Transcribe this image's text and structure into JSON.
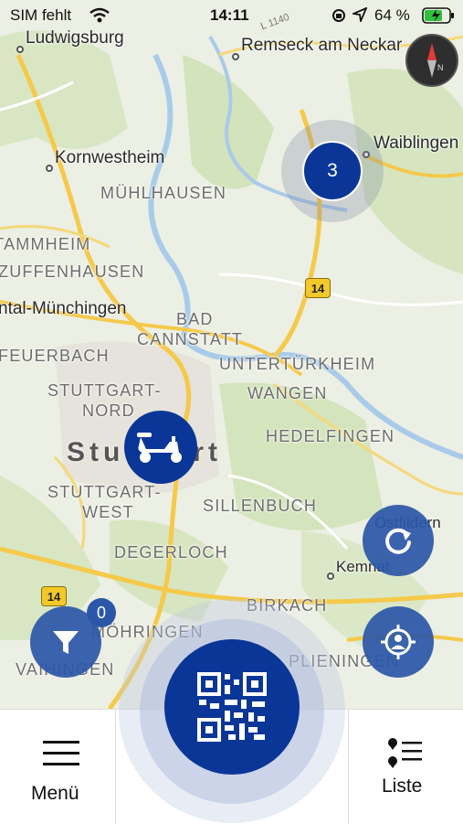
{
  "status_bar": {
    "carrier": "SIM fehlt",
    "time": "14:11",
    "battery": "64 %"
  },
  "map": {
    "places": [
      "Ludwigsburg",
      "Remseck am Neckar",
      "Kornwestheim",
      "Waiblingen",
      "Kemnat",
      "Ostfildern"
    ],
    "districts": [
      "MÜHLHAUSEN",
      "ZUFFENHAUSEN",
      "STAMMHEIM",
      "BAD",
      "CANNSTATT",
      "UNTERTÜRKHEIM",
      "FEUERBACH",
      "STUTTGART-",
      "NORD",
      "WANGEN",
      "HEDELFINGEN",
      "STUTTGART-",
      "WEST",
      "SILLENBUCH",
      "DEGERLOCH",
      "BIRKACH",
      "MÖHRINGEN",
      "VAIHINGEN",
      "PLIENINGEN"
    ],
    "city": "Stuttgart",
    "partial_place": "ntal-Münchingen",
    "road_labels": [
      "14",
      "14",
      "L 1140"
    ],
    "cluster_count": "3",
    "filter_badge": "0"
  },
  "nav": {
    "menu_label": "Menü",
    "list_label": "Liste"
  },
  "colors": {
    "brand_blue": "#0a3697",
    "button_blue": "#2c57a8",
    "road_yellow": "#f3c92a"
  }
}
